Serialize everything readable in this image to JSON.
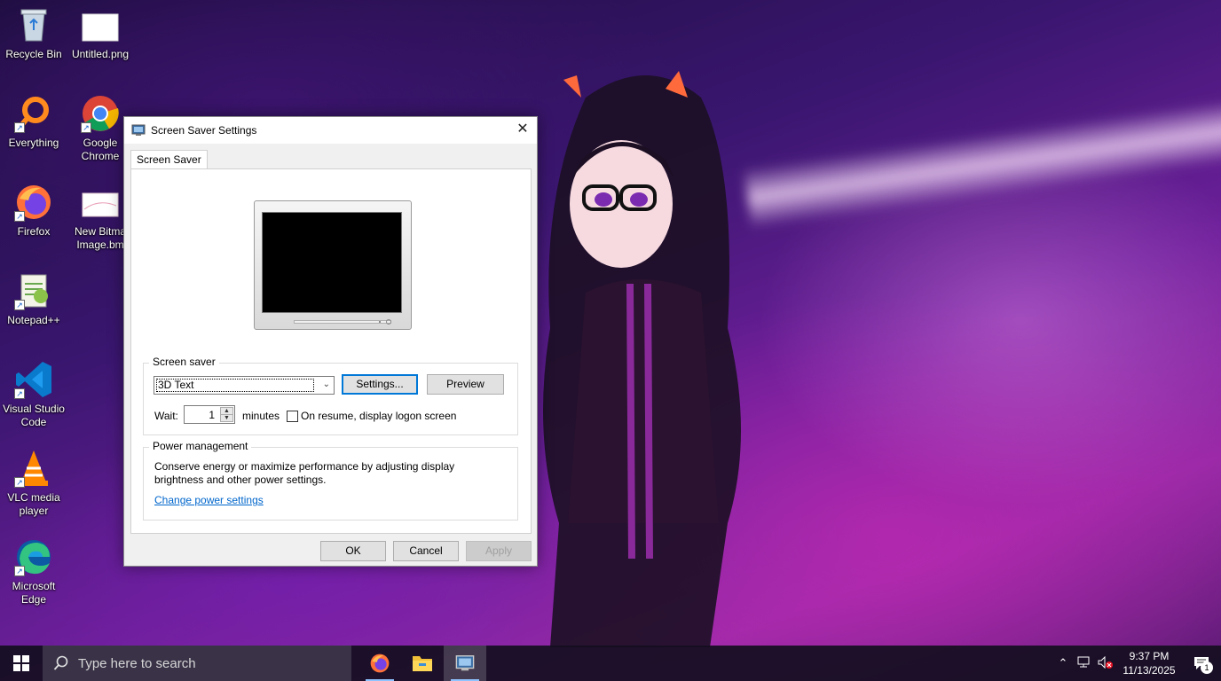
{
  "desktop": {
    "icons": [
      {
        "label": "Recycle Bin",
        "icon": "recycle-bin-icon"
      },
      {
        "label": "Untitled.png",
        "icon": "image-file-icon"
      },
      {
        "label": "Everything",
        "icon": "everything-search-icon"
      },
      {
        "label": "Google Chrome",
        "icon": "chrome-icon"
      },
      {
        "label": "Firefox",
        "icon": "firefox-icon"
      },
      {
        "label": "New Bitmap Image.bmp",
        "icon": "bitmap-file-icon",
        "visible_label": "New Bitma\nImage.bm"
      },
      {
        "label": "Notepad++",
        "icon": "notepadpp-icon"
      },
      {
        "label": "Visual Studio Code",
        "icon": "vscode-icon"
      },
      {
        "label": "VLC media player",
        "icon": "vlc-icon"
      },
      {
        "label": "Microsoft Edge",
        "icon": "edge-icon"
      }
    ]
  },
  "dialog": {
    "title": "Screen Saver Settings",
    "close_glyph": "✕",
    "tab": "Screen Saver",
    "screen_saver_group": {
      "label": "Screen saver",
      "selected": "3D Text",
      "settings_button": "Settings...",
      "preview_button": "Preview",
      "wait_label": "Wait:",
      "wait_value": "1",
      "minutes_label": "minutes",
      "resume_checkbox_label": "On resume, display logon screen",
      "resume_checked": false
    },
    "power_group": {
      "label": "Power management",
      "description_line1": "Conserve energy or maximize performance by adjusting display",
      "description_line2": "brightness and other power settings.",
      "link": "Change power settings"
    },
    "buttons": {
      "ok": "OK",
      "cancel": "Cancel",
      "apply": "Apply"
    }
  },
  "taskbar": {
    "search_placeholder": "Type here to search",
    "apps": [
      {
        "name": "Firefox",
        "icon": "firefox-icon"
      },
      {
        "name": "File Explorer",
        "icon": "folder-icon"
      },
      {
        "name": "Screen Saver Settings",
        "icon": "display-settings-icon",
        "active": true
      }
    ],
    "tray": {
      "time": "9:37 PM",
      "date": "11/13/2025",
      "notification_count": "1"
    }
  },
  "colors": {
    "accent": "#0078d7",
    "link": "#0066cc",
    "taskbar": "#140e20"
  }
}
